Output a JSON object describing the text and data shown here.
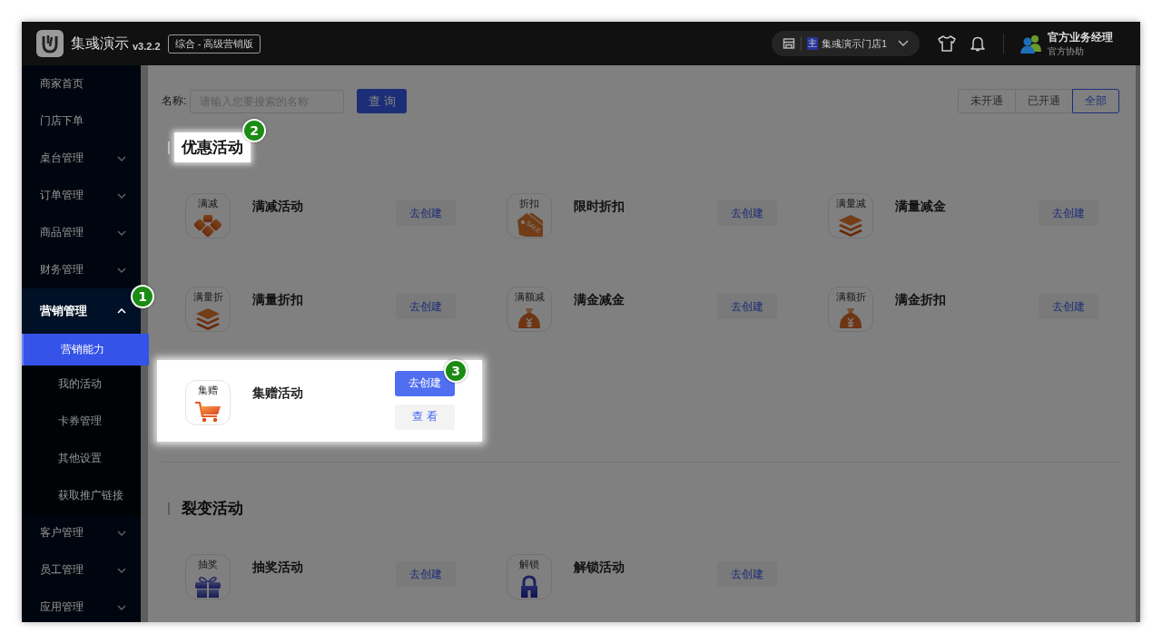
{
  "header": {
    "logo_text": "集彧演示",
    "version": "v3.2.2",
    "edition": "综合 - 高级营销版",
    "store": {
      "tag": "主",
      "name": "集彧演示门店1"
    },
    "user": {
      "name": "官方业务经理",
      "role": "官方协助"
    }
  },
  "sidebar": {
    "items": [
      {
        "label": "商家首页",
        "kind": "link"
      },
      {
        "label": "门店下单",
        "kind": "link"
      },
      {
        "label": "桌台管理",
        "kind": "group",
        "expanded": false
      },
      {
        "label": "订单管理",
        "kind": "group",
        "expanded": false
      },
      {
        "label": "商品管理",
        "kind": "group",
        "expanded": false
      },
      {
        "label": "财务管理",
        "kind": "group",
        "expanded": false
      },
      {
        "label": "营销管理",
        "kind": "group",
        "expanded": true,
        "badge": "1",
        "children": [
          {
            "label": "营销能力",
            "selected": true
          },
          {
            "label": "我的活动",
            "selected": false
          },
          {
            "label": "卡券管理",
            "selected": false
          },
          {
            "label": "其他设置",
            "selected": false
          },
          {
            "label": "获取推广链接",
            "selected": false
          }
        ]
      },
      {
        "label": "客户管理",
        "kind": "group",
        "expanded": false
      },
      {
        "label": "员工管理",
        "kind": "group",
        "expanded": false
      },
      {
        "label": "应用管理",
        "kind": "group",
        "expanded": false
      }
    ]
  },
  "search": {
    "label": "名称:",
    "placeholder": "请输入您要搜索的名称",
    "button": "查 询"
  },
  "filters": [
    {
      "label": "未开通",
      "selected": false
    },
    {
      "label": "已开通",
      "selected": false
    },
    {
      "label": "全部",
      "selected": true
    }
  ],
  "sections": [
    {
      "title": "优惠活动",
      "highlighted": true,
      "badge": "2",
      "activities": [
        {
          "name": "满减活动",
          "icon_label": "满减",
          "kind": "diamonds",
          "highlighted": false,
          "buttons": [
            {
              "label": "去创建",
              "kind": "secondary"
            }
          ]
        },
        {
          "name": "限时折扣",
          "icon_label": "折扣",
          "kind": "tag",
          "icon_text": "SALE",
          "highlighted": false,
          "buttons": [
            {
              "label": "去创建",
              "kind": "secondary"
            }
          ]
        },
        {
          "name": "满量减金",
          "icon_label": "满量减",
          "kind": "layers",
          "highlighted": false,
          "buttons": [
            {
              "label": "去创建",
              "kind": "secondary"
            }
          ]
        },
        {
          "name": "满量折扣",
          "icon_label": "满量折",
          "kind": "layers",
          "highlighted": false,
          "buttons": [
            {
              "label": "去创建",
              "kind": "secondary"
            }
          ]
        },
        {
          "name": "满金减金",
          "icon_label": "满额减",
          "kind": "moneybag",
          "highlighted": false,
          "buttons": [
            {
              "label": "去创建",
              "kind": "secondary"
            }
          ]
        },
        {
          "name": "满金折扣",
          "icon_label": "满额折",
          "kind": "moneybag",
          "highlighted": false,
          "buttons": [
            {
              "label": "去创建",
              "kind": "secondary"
            }
          ]
        },
        {
          "name": "集赠活动",
          "icon_label": "集赠",
          "kind": "cart",
          "highlighted": true,
          "buttons": [
            {
              "label": "去创建",
              "kind": "primary",
              "badge": "3"
            },
            {
              "label": "查 看",
              "kind": "secondary"
            }
          ]
        }
      ]
    },
    {
      "title": "裂变活动",
      "highlighted": false,
      "activities": [
        {
          "name": "抽奖活动",
          "icon_label": "抽奖",
          "kind": "gift",
          "highlighted": false,
          "buttons": [
            {
              "label": "去创建",
              "kind": "secondary"
            }
          ]
        },
        {
          "name": "解锁活动",
          "icon_label": "解锁",
          "kind": "lock",
          "highlighted": false,
          "buttons": [
            {
              "label": "去创建",
              "kind": "secondary"
            }
          ]
        }
      ]
    }
  ]
}
